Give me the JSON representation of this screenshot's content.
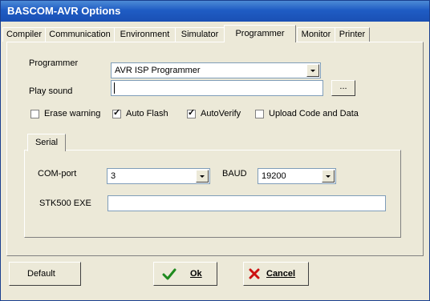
{
  "window": {
    "title": "BASCOM-AVR Options"
  },
  "tabs": [
    "Compiler",
    "Communication",
    "Environment",
    "Simulator",
    "Programmer",
    "Monitor",
    "Printer"
  ],
  "active_tab": "Programmer",
  "programmer": {
    "programmer_label": "Programmer",
    "programmer_value": "AVR ISP Programmer",
    "play_sound_label": "Play sound",
    "play_sound_value": "",
    "browse_label": "...",
    "checkboxes": [
      {
        "label": "Erase warning",
        "checked": false
      },
      {
        "label": "Auto Flash",
        "checked": true
      },
      {
        "label": "AutoVerify",
        "checked": true
      },
      {
        "label": "Upload Code and Data",
        "checked": false
      }
    ]
  },
  "serial": {
    "tab_label": "Serial",
    "comport_label": "COM-port",
    "comport_value": "3",
    "baud_label": "BAUD",
    "baud_value": "19200",
    "stk_label": "STK500 EXE",
    "stk_value": ""
  },
  "buttons": {
    "default_label": "Default",
    "ok_label": "Ok",
    "cancel_label": "Cancel"
  },
  "icons": {
    "ok": "check-icon",
    "cancel": "x-icon"
  },
  "colors": {
    "title_bar": "#1f5cc4",
    "ok_green": "#1e8a1e",
    "cancel_red": "#cc1111"
  }
}
